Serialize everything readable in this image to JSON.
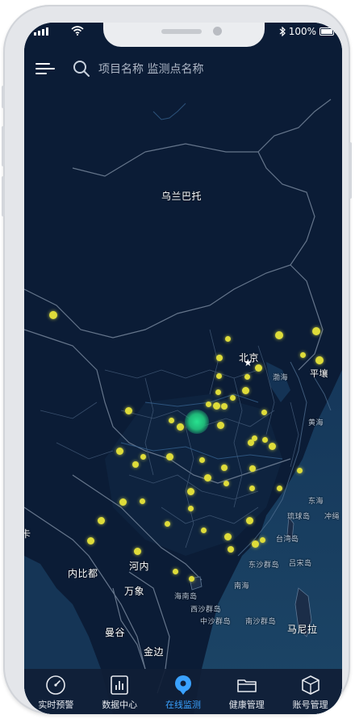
{
  "status_bar": {
    "battery": "100%"
  },
  "search": {
    "placeholder": "项目名称 监测点名称"
  },
  "map": {
    "labels": {
      "ulaanbaatar": "乌兰巴托",
      "beijing": "北京",
      "bohai": "渤海",
      "pyongyang": "平壤",
      "yellow_sea": "黄海",
      "east_sea": "东海",
      "ryukyu": "琉球岛",
      "okinawa": "冲绳",
      "taiwan": "台湾岛",
      "dongsha": "东沙群岛",
      "hanoi": "河内",
      "luzon": "吕宋岛",
      "vientiane": "万象",
      "hainan": "海南岛",
      "xisha": "西沙群岛",
      "zhongsha": "中沙群岛",
      "bangkok": "曼谷",
      "nansha": "南沙群岛",
      "manila": "马尼拉",
      "phnom_penh": "金边",
      "naypyidaw": "内比都",
      "dhaka": "卡"
    }
  },
  "tabs": [
    {
      "label": "实时预警",
      "icon": "gauge-icon",
      "active": false
    },
    {
      "label": "数据中心",
      "icon": "bar-chart-icon",
      "active": false
    },
    {
      "label": "在线监测",
      "icon": "location-pin-icon",
      "active": true
    },
    {
      "label": "健康管理",
      "icon": "folder-icon",
      "active": false
    },
    {
      "label": "账号管理",
      "icon": "cube-icon",
      "active": false
    }
  ],
  "colors": {
    "map_background": "#0b1c36",
    "marker": "#dedc3a",
    "highlight_marker": "#28e28f",
    "active_tab": "#3aa2ff"
  }
}
